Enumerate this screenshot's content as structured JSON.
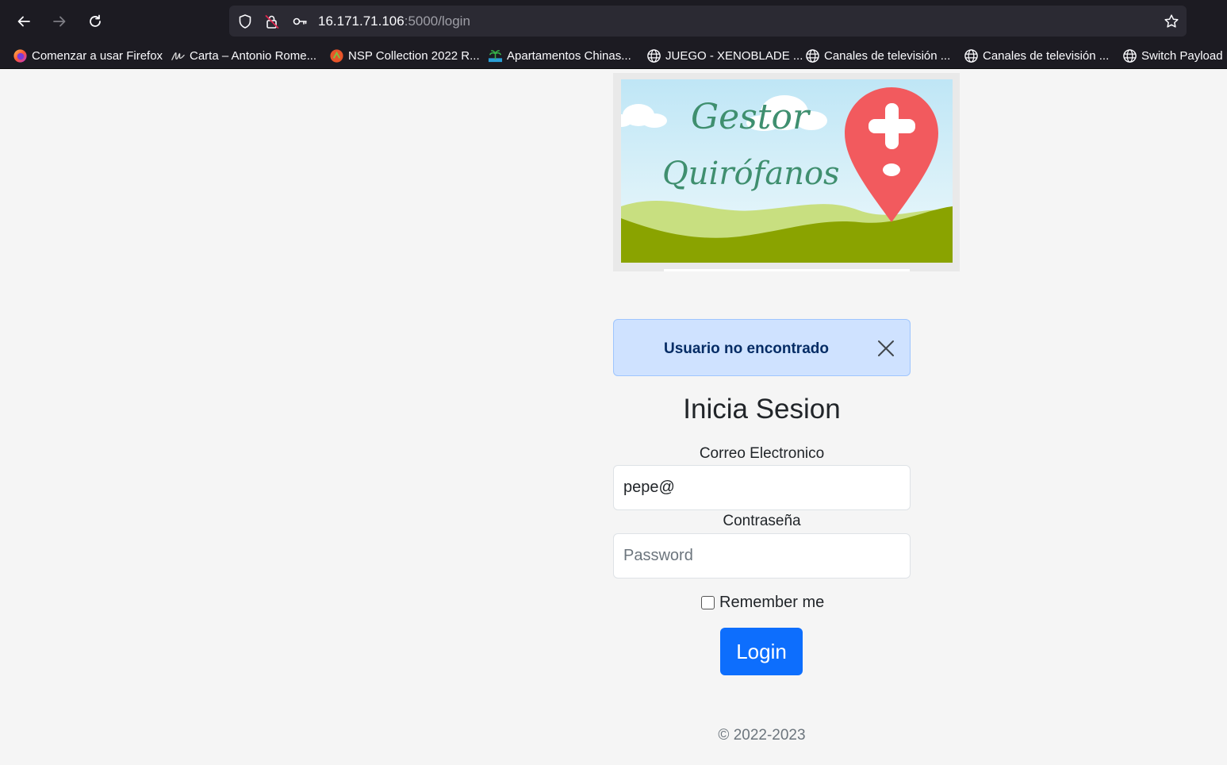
{
  "browser": {
    "url_host": "16.171.71.106",
    "url_path": ":5000/login",
    "bookmarks": [
      {
        "label": "Comenzar a usar Firefox",
        "icon": "firefox-icon"
      },
      {
        "label": "Carta – Antonio Rome...",
        "icon": "signature-icon"
      },
      {
        "label": "NSP Collection 2022 R...",
        "icon": "nsp-icon"
      },
      {
        "label": "Apartamentos Chinas...",
        "icon": "palm-icon"
      },
      {
        "label": "JUEGO - XENOBLADE ...",
        "icon": "globe-icon"
      },
      {
        "label": "Canales de televisión ...",
        "icon": "globe-icon"
      },
      {
        "label": "Canales de televisión ...",
        "icon": "globe-icon"
      },
      {
        "label": "Switch Payload L",
        "icon": "globe-icon"
      }
    ]
  },
  "banner": {
    "line1": "Gestor",
    "line2": "Quirófanos",
    "colors": {
      "sky": "#cdeefa",
      "hill_light": "#c8df80",
      "hill_dark": "#8aa300",
      "pin": "#f25a5e",
      "script": "#3f8f6f"
    }
  },
  "alert": {
    "message": "Usuario no encontrado"
  },
  "form": {
    "title": "Inicia Sesion",
    "email_label": "Correo Electronico",
    "email_value": "pepe@",
    "password_label": "Contraseña",
    "password_placeholder": "Password",
    "remember_label": "Remember me",
    "submit_label": "Login"
  },
  "footer": {
    "text": "© 2022-2023"
  },
  "colors": {
    "primary": "#0d6efd",
    "alert_bg": "#cfe2ff",
    "alert_text": "#052c65"
  }
}
